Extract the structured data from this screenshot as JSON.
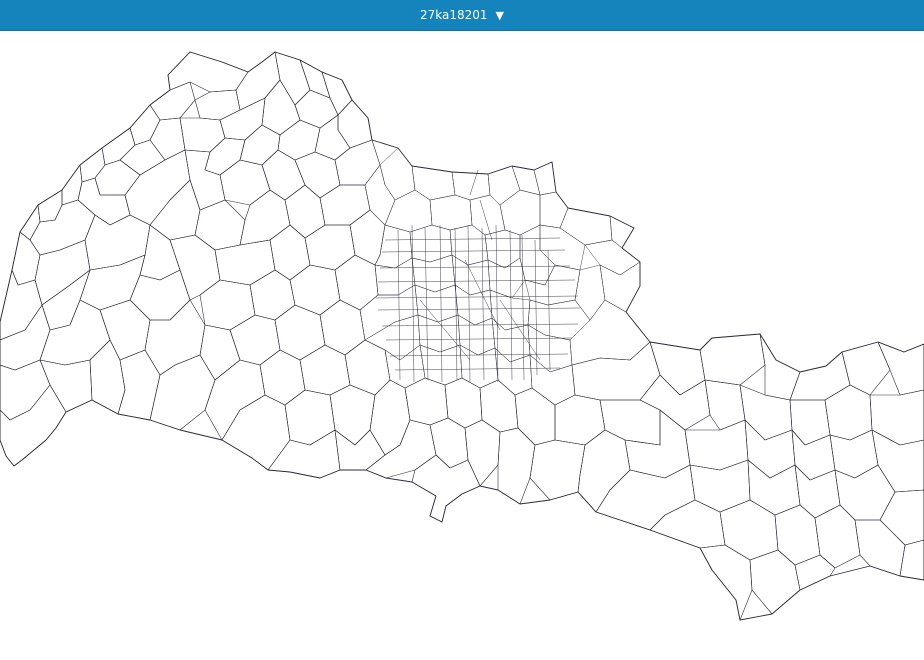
{
  "header": {
    "title": "27ka18201",
    "caret_icon": "triangle-down-icon",
    "background": "#1584bd",
    "text_color": "#ffffff"
  },
  "map": {
    "stroke_color": "#2b2b3a",
    "fill": "none"
  }
}
